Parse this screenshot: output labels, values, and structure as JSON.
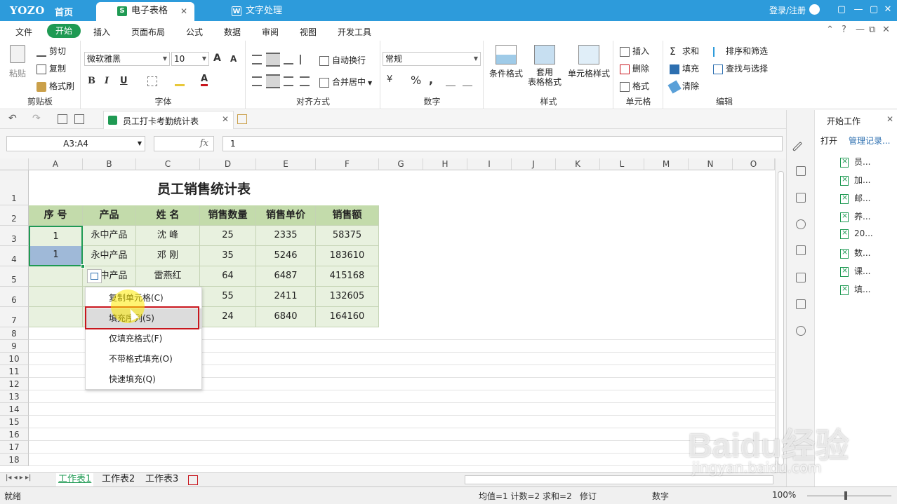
{
  "titlebar": {
    "logo": "YOZO",
    "home": "首页",
    "tabs": [
      {
        "label": "电子表格",
        "icon": "S",
        "active": true
      },
      {
        "label": "文字处理",
        "icon": "W",
        "active": false
      }
    ],
    "tab_close": "✕",
    "login": "登录/注册",
    "window_buttons": [
      "▢",
      "—",
      "▢",
      "✕"
    ]
  },
  "ribbon_tabs": [
    "文件",
    "开始",
    "插入",
    "页面布局",
    "公式",
    "数据",
    "审阅",
    "视图",
    "开发工具"
  ],
  "ribbon_controls": [
    "⌃",
    "?",
    "—",
    "⧉",
    "✕"
  ],
  "ribbon": {
    "clipboard": {
      "paste": "粘贴",
      "cut": "剪切",
      "copy": "复制",
      "format_painter": "格式刷",
      "label": "剪贴板"
    },
    "font": {
      "name": "微软雅黑",
      "size": "10",
      "grow": "A",
      "shrink": "A",
      "bold": "B",
      "italic": "I",
      "underline": "U",
      "color": "A",
      "label": "字体"
    },
    "align": {
      "wrap": "自动换行",
      "merge": "合并居中",
      "label": "对齐方式"
    },
    "number": {
      "format": "常规",
      "currency": "¥",
      "percent": "%",
      "comma": ",",
      "label": "数字"
    },
    "style": {
      "conditional": "条件格式",
      "table_l1": "套用",
      "table_l2": "表格格式",
      "cell_style": "单元格样式",
      "label": "样式"
    },
    "cells": {
      "insert": "插入",
      "delete": "删除",
      "format": "格式",
      "label": "单元格"
    },
    "edit": {
      "sum": "求和",
      "sort_filter": "排序和筛选",
      "fill": "填充",
      "find": "查找与选择",
      "clear": "清除",
      "label": "编辑"
    }
  },
  "quickbar": {
    "doc_tab": "员工打卡考勤统计表",
    "close": "✕"
  },
  "formula_bar": {
    "name_box": "A3:A4",
    "fx": "fx",
    "value": "1"
  },
  "columns": [
    "A",
    "B",
    "C",
    "D",
    "E",
    "F",
    "G",
    "H",
    "I",
    "J",
    "K",
    "L",
    "M",
    "N",
    "O"
  ],
  "rows": [
    "1",
    "2",
    "3",
    "4",
    "5",
    "6",
    "7",
    "8",
    "9",
    "10",
    "11",
    "12",
    "13",
    "14",
    "15",
    "16",
    "17",
    "18"
  ],
  "sheet": {
    "title": "员工销售统计表",
    "headers": [
      "序 号",
      "产品",
      "姓  名",
      "销售数量",
      "销售单价",
      "销售额"
    ],
    "rows": [
      [
        "1",
        "永中产品",
        "沈  峰",
        "25",
        "2335",
        "58375"
      ],
      [
        "1",
        "永中产品",
        "邓  刚",
        "35",
        "5246",
        "183610"
      ],
      [
        "",
        "永中产品",
        "雷燕红",
        "64",
        "6487",
        "415168"
      ],
      [
        "",
        "",
        "",
        "55",
        "2411",
        "132605"
      ],
      [
        "",
        "",
        "",
        "24",
        "6840",
        "164160"
      ]
    ]
  },
  "context_menu": [
    "复制单元格(C)",
    "填充序列(S)",
    "仅填充格式(F)",
    "不带格式填充(O)",
    "快速填充(Q)"
  ],
  "sheet_tabs": [
    "工作表1",
    "工作表2",
    "工作表3"
  ],
  "status": {
    "ready": "就绪",
    "summary": "均值=1  计数=2  求和=2",
    "revise": "修订",
    "numlock": "数字",
    "zoom": "100%"
  },
  "right_panel": {
    "title": "开始工作",
    "open": "打开",
    "manage": "管理记录...",
    "files": [
      "员...",
      "加...",
      "邮...",
      "养...",
      "20...",
      "数...",
      "课...",
      "填..."
    ]
  },
  "watermark": {
    "main": "Baidu经验",
    "sub": "jingyan.baidu.com"
  },
  "colors": {
    "accent": "#2d9bdb",
    "green": "#1f9a53",
    "header_fill": "#c3dbab",
    "data_fill": "#e8f1df",
    "highlight": "#c8161d"
  }
}
